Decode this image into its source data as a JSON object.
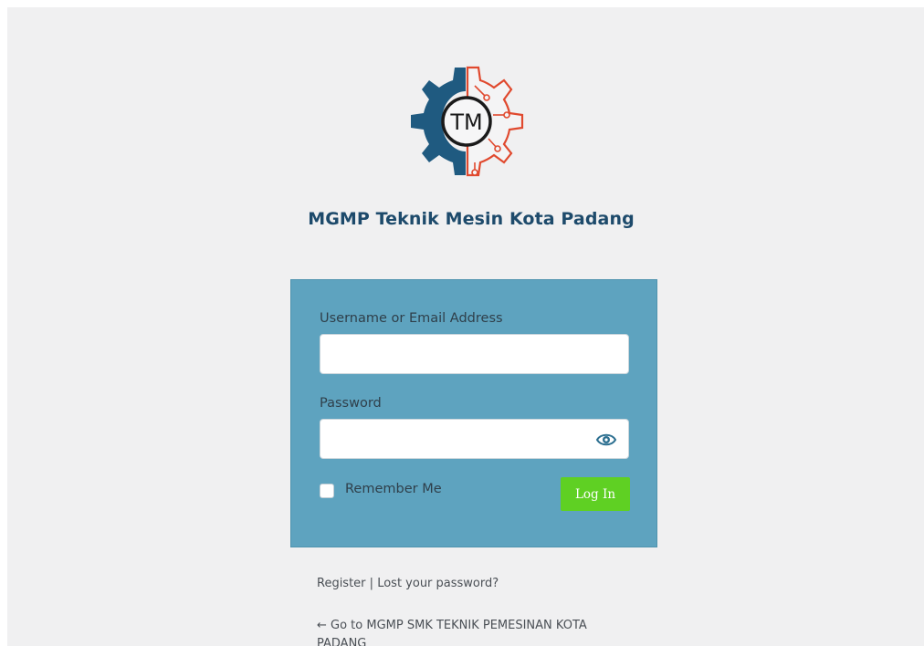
{
  "logo": {
    "mark_text": "TM",
    "brand_name": "MGMP Teknik Mesin Kota Padang",
    "colors": {
      "left_gear": "#1f5a80",
      "right_gear": "#e0492e",
      "circle": "#1a1a1a"
    }
  },
  "form": {
    "username_label": "Username or Email Address",
    "username_value": "",
    "password_label": "Password",
    "password_value": "",
    "show_password_icon": "eye-icon",
    "remember_label": "Remember Me",
    "remember_checked": false,
    "login_button": "Log In",
    "colors": {
      "panel": "#5ea3bf",
      "button": "#5fd023"
    }
  },
  "footer": {
    "register": "Register",
    "separator": "|",
    "lost_password": "Lost your password?",
    "back_link": "← Go to MGMP SMK TEKNIK PEMESINAN KOTA PADANG"
  }
}
